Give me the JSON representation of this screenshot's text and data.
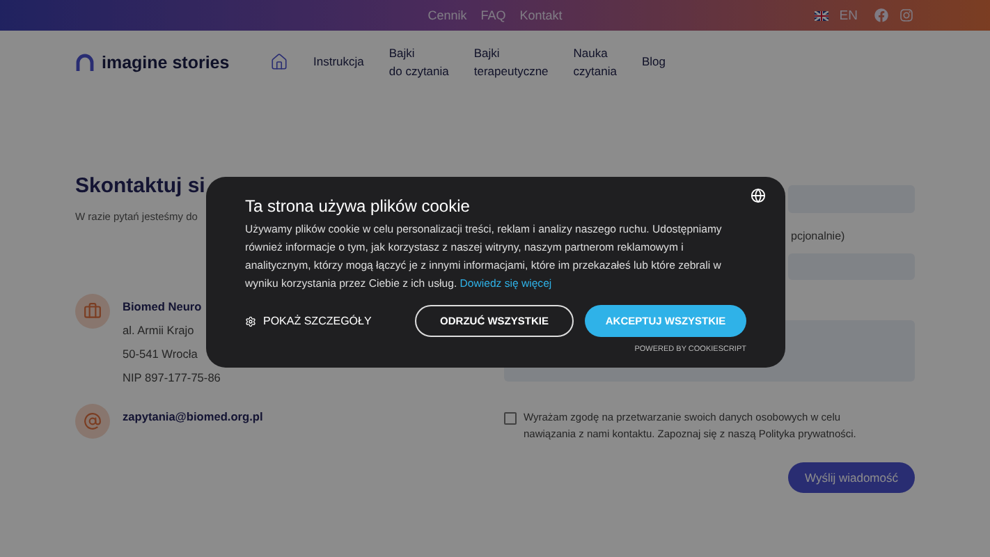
{
  "top_bar": {
    "links": [
      "Cennik",
      "FAQ",
      "Kontakt"
    ],
    "language": "EN"
  },
  "header": {
    "logo": "imagine stories",
    "nav": [
      {
        "lines": [
          "Instrukcja"
        ],
        "kind": "home"
      },
      {
        "lines": [
          "Bajki",
          "do czytania"
        ],
        "kind": "link"
      },
      {
        "lines": [
          "Bajki",
          "terapeutyczne"
        ],
        "kind": "link"
      },
      {
        "lines": [
          "Nauka",
          "czytania"
        ],
        "kind": "link"
      },
      {
        "lines": [
          "Blog"
        ],
        "kind": "link"
      }
    ]
  },
  "contact": {
    "title": "Skontaktuj si",
    "intro": "W razie pytań jesteśmy do",
    "company": "Biomed Neuro",
    "address": [
      "al. Armii Krajo",
      "50-541 Wrocła",
      "NIP 897-177-75-86"
    ],
    "email": "zapytania@biomed.org.pl"
  },
  "form": {
    "phone_label": "pcjonalnie)",
    "consent": {
      "text": "Wyrażam zgodę na przetwarzanie swoich danych osobowych w celu nawiązania z nami kontaktu. Zapoznaj się z naszą Polityka prywatności.",
      "checked": false
    },
    "submit": "Wyślij wiadomość"
  },
  "cookie_banner": {
    "title": "Ta strona używa plików cookie",
    "body": "Używamy plików cookie w celu personalizacji treści, reklam i analizy naszego ruchu. Udostępniamy również informacje o tym, jak korzystasz z naszej witryny, naszym partnerom reklamowym i analitycznym, którzy mogą łączyć je z innymi informacjami, które im przekazałeś lub które zebrali w wyniku korzystania przez Ciebie z ich usług.",
    "link": "Dowiedz się więcej",
    "buttons": [
      {
        "label": "POKAŻ SZCZEGÓŁY",
        "kind": "details"
      },
      {
        "label": "ODRZUĆ WSZYSTKIE",
        "kind": "outline"
      },
      {
        "label": "AKCEPTUJ WSZYSTKIE",
        "kind": "primary"
      }
    ],
    "powered_by": "POWERED BY COOKIESCRIPT"
  }
}
